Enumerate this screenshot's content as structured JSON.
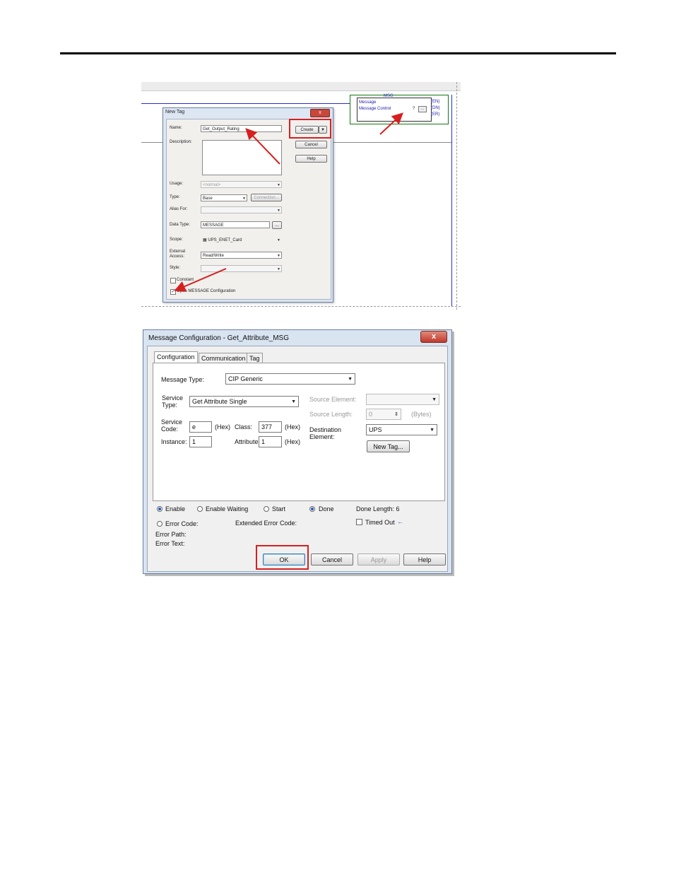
{
  "new_tag_dialog": {
    "title": "New Tag",
    "close": "x",
    "name_label": "Name:",
    "name_value": "Get_Output_Rating",
    "description_label": "Description:",
    "usage_label": "Usage:",
    "usage_value": "<normal>",
    "type_label": "Type:",
    "type_value": "Base",
    "connection_button": "Connection...",
    "alias_label": "Alias For:",
    "data_type_label": "Data Type:",
    "data_type_value": "MESSAGE",
    "browse_button": "...",
    "scope_label": "Scope:",
    "scope_value": "UPS_ENET_Card",
    "external_label_1": "External",
    "external_label_2": "Access:",
    "external_value": "Read/Write",
    "style_label": "Style:",
    "constant_label": "Constant",
    "open_msg_label": "Open MESSAGE Configuration",
    "create_button": "Create",
    "cancel_button": "Cancel",
    "help_button": "Help"
  },
  "ladder": {
    "msg_title": "MSG",
    "msg_line1": "Message",
    "msg_line2": "Message Control",
    "msg_control_value": "?",
    "browse_button": "...",
    "outputs": [
      "(EN)",
      "(DN)",
      "(ER)"
    ]
  },
  "msg_dialog": {
    "title": "Message Configuration - Get_Attribute_MSG",
    "close": "x",
    "tabs": [
      "Configuration",
      "Communication",
      "Tag"
    ],
    "message_type_label": "Message Type:",
    "message_type_value": "CIP Generic",
    "service_type_label_1": "Service",
    "service_type_label_2": "Type:",
    "service_type_value": "Get Attribute Single",
    "service_code_label_1": "Service",
    "service_code_label_2": "Code:",
    "service_code_value": "e",
    "hex1": "(Hex)",
    "class_label": "Class:",
    "class_value": "377",
    "hex2": "(Hex)",
    "instance_label": "Instance:",
    "instance_value": "1",
    "attribute_label": "Attribute:",
    "attribute_value": "1",
    "hex3": "(Hex)",
    "source_element_label": "Source Element:",
    "source_length_label": "Source Length:",
    "source_length_value": "0",
    "bytes_label": "(Bytes)",
    "destination_label_1": "Destination",
    "destination_label_2": "Element:",
    "destination_value": "UPS",
    "new_tag_button": "New Tag...",
    "enable": "Enable",
    "enable_waiting": "Enable Waiting",
    "start": "Start",
    "done": "Done",
    "done_length": "Done Length: 6",
    "error_code": "Error Code:",
    "extended_error_code": "Extended Error Code:",
    "timed_out": "Timed Out",
    "timed_out_arrow": "←",
    "error_path": "Error Path:",
    "error_text": "Error Text:",
    "ok_button": "OK",
    "cancel_button": "Cancel",
    "apply_button": "Apply",
    "help_button": "Help"
  },
  "colors": {
    "callout": "#d62020",
    "ladder_blue": "#2b2bd0",
    "radio_fill": "#2758c9"
  }
}
